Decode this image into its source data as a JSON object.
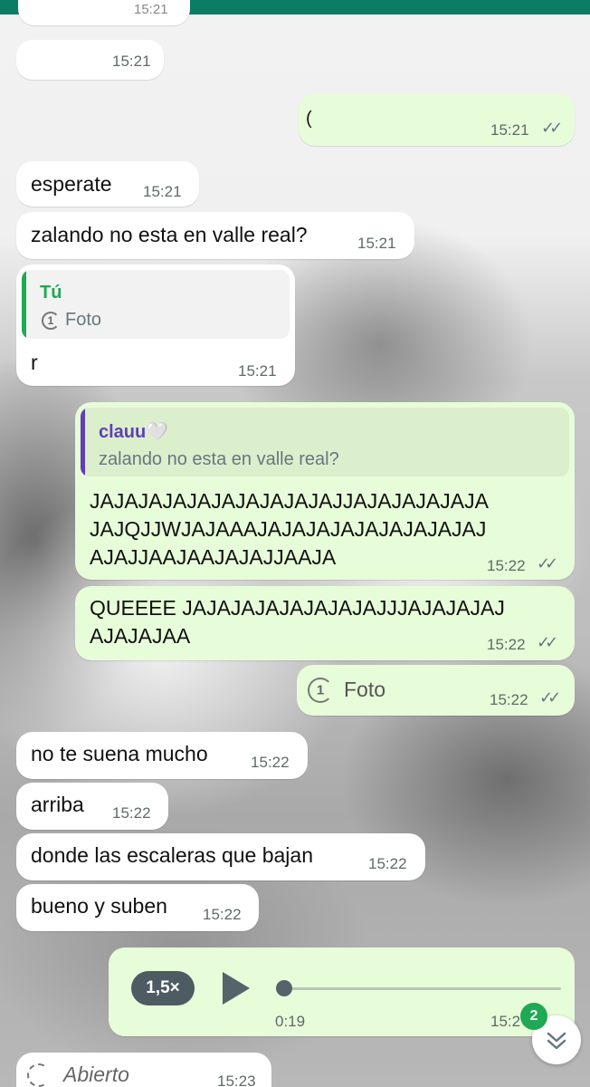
{
  "chat": {
    "top_partial_time": "15:21",
    "messages": [
      {
        "id": "m1",
        "from": "contact",
        "text": "",
        "time": "15:21"
      },
      {
        "id": "m2",
        "from": "me",
        "text": "(",
        "time": "15:21",
        "status": "read"
      },
      {
        "id": "m3",
        "from": "contact",
        "text": "esperate",
        "time": "15:21"
      },
      {
        "id": "m4",
        "from": "contact",
        "text": "zalando no esta en valle real?",
        "time": "15:21"
      },
      {
        "id": "m5",
        "from": "contact",
        "reply_author": "Tú",
        "reply_icon_label": "1",
        "reply_text": "Foto",
        "text": "r",
        "time": "15:21"
      },
      {
        "id": "m6",
        "from": "me",
        "reply_author": "clauu🤍",
        "reply_text": "zalando no esta en valle real?",
        "lines": [
          "JAJAJAJAJAJAJAJAJAJAJJAJAJAJAJAJA",
          "JAJQJJWJAJAAAJAJAJAJAJAJAJAJAJAJ",
          "AJAJJAAJAAJAJAJJAAJA"
        ],
        "time": "15:22",
        "status": "read"
      },
      {
        "id": "m7",
        "from": "me",
        "lines": [
          "QUEEEE JAJAJAJAJAJAJAJAJJJAJAJAJAJ",
          "AJAJAJAA"
        ],
        "time": "15:22",
        "status": "read"
      },
      {
        "id": "m8",
        "from": "me",
        "view_once_label": "1",
        "text": "Foto",
        "time": "15:22",
        "status": "read"
      },
      {
        "id": "m9",
        "from": "contact",
        "text": "no te suena mucho",
        "time": "15:22"
      },
      {
        "id": "m10",
        "from": "contact",
        "text": "arriba",
        "time": "15:22"
      },
      {
        "id": "m11",
        "from": "contact",
        "text": "donde las escaleras que bajan",
        "time": "15:22"
      },
      {
        "id": "m12",
        "from": "contact",
        "text": "bueno y suben",
        "time": "15:22"
      },
      {
        "id": "m13",
        "from": "me",
        "type": "voice",
        "speed": "1,5×",
        "duration": "0:19",
        "progress": 0,
        "time": "15:2",
        "status": "read"
      },
      {
        "id": "m14",
        "from": "contact",
        "text": "Abierto",
        "time": "15:23"
      }
    ]
  },
  "scroll_down": {
    "unread_count": "2"
  },
  "colors": {
    "header_green": "#0b7d62",
    "outgoing_bubble": "#e7fcd8",
    "incoming_bubble": "#ffffff",
    "reply_bar_me": "#1fa855",
    "reply_bar_contact": "#5e3fb8",
    "read_ticks": "#667781"
  },
  "icons": {
    "read": "double-check-icon",
    "view_once": "view-once-icon",
    "play": "play-icon",
    "scroll": "double-chevron-down-icon"
  }
}
